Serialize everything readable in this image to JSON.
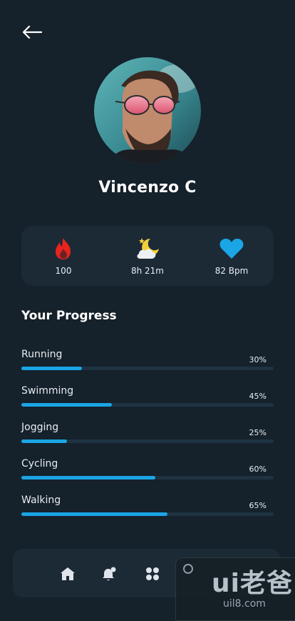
{
  "profile": {
    "name": "Vincenzo C"
  },
  "stats": [
    {
      "icon": "flame-icon",
      "value": "100"
    },
    {
      "icon": "moon-cloud-icon",
      "value": "8h 21m"
    },
    {
      "icon": "heart-icon",
      "value": "82 Bpm"
    }
  ],
  "progress": {
    "title": "Your Progress",
    "items": [
      {
        "label": "Running",
        "percent_text": "30%",
        "percent": 24
      },
      {
        "label": "Swimming",
        "percent_text": "45%",
        "percent": 36
      },
      {
        "label": "Jogging",
        "percent_text": "25%",
        "percent": 18
      },
      {
        "label": "Cycling",
        "percent_text": "60%",
        "percent": 53
      },
      {
        "label": "Walking",
        "percent_text": "65%",
        "percent": 58
      }
    ]
  },
  "nav": {
    "items": [
      "home-icon",
      "notification-bell-icon",
      "grid-apps-icon"
    ]
  },
  "watermark": {
    "logo": "ui老爸",
    "url": "uil8.com"
  },
  "colors": {
    "background": "#15212b",
    "card": "#1c2a36",
    "accent": "#1aa5e5",
    "flame": "#e8241d",
    "heart": "#1aa5e5"
  }
}
